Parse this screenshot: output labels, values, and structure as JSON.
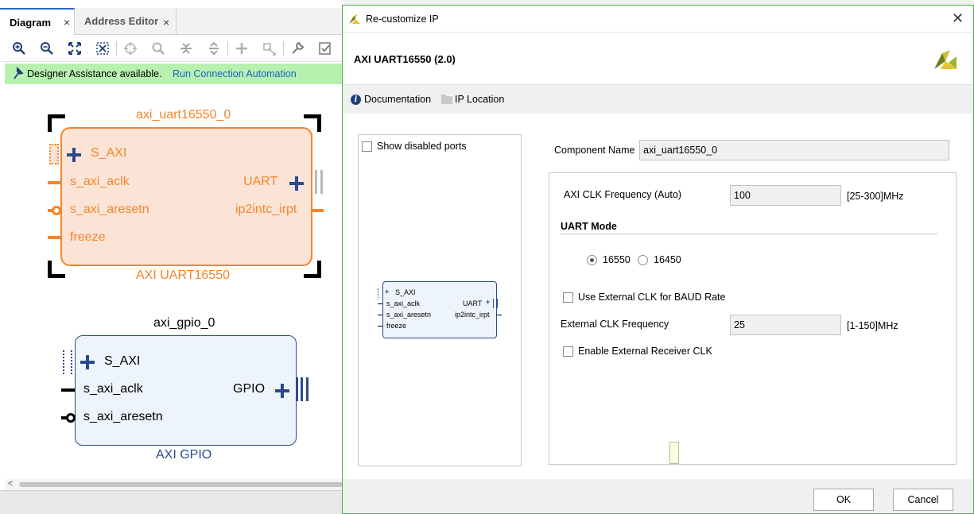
{
  "left_panel": {
    "tabs": [
      {
        "label": "Diagram",
        "active": true
      },
      {
        "label": "Address Editor",
        "active": false
      }
    ],
    "tab_close_glyph": "×",
    "toolbar_icons": [
      "zoom-in-icon",
      "zoom-out-icon",
      "fit-full-icon",
      "fit-selection-icon",
      "crosshair-icon",
      "search-icon",
      "collapse-icon",
      "expand-icon",
      "add-icon",
      "ports-icon",
      "wrench-icon",
      "validate-icon"
    ],
    "assistance": {
      "text": "Designer Assistance available.",
      "link": "Run Connection Automation",
      "color": "#b8f0b0"
    },
    "uart_block": {
      "instance": "axi_uart16550_0",
      "type_label": "AXI UART16550",
      "ports_left": [
        "S_AXI",
        "s_axi_aclk",
        "s_axi_aresetn",
        "freeze"
      ],
      "ports_right": [
        "UART",
        "ip2intc_irpt"
      ],
      "color": "#f5842a",
      "fill": "#fbe4d6"
    },
    "gpio_block": {
      "instance": "axi_gpio_0",
      "type_label": "AXI GPIO",
      "ports_left": [
        "S_AXI",
        "s_axi_aclk",
        "s_axi_aresetn"
      ],
      "ports_right": [
        "GPIO"
      ],
      "color": "#2b4a8c",
      "fill": "#eef4fb"
    }
  },
  "dialog": {
    "title": "Re-customize IP",
    "close_glyph": "✕",
    "ip_name": "AXI UART16550 (2.0)",
    "links": {
      "documentation": "Documentation",
      "ip_location": "IP Location"
    },
    "show_disabled_ports": {
      "label": "Show disabled ports",
      "checked": false
    },
    "preview_ports_left": [
      "S_AXI",
      "s_axi_aclk",
      "s_axi_aresetn",
      "freeze"
    ],
    "preview_ports_right": [
      "UART",
      "ip2intc_irpt"
    ],
    "component_name": {
      "label": "Component Name",
      "value": "axi_uart16550_0"
    },
    "axi_clk": {
      "label": "AXI CLK Frequency (Auto)",
      "value": "100",
      "range": "[25-300]MHz"
    },
    "uart_mode": {
      "heading": "UART Mode",
      "options": [
        "16550",
        "16450"
      ],
      "selected": "16550"
    },
    "use_ext_clk": {
      "label": "Use External CLK for BAUD Rate",
      "checked": false
    },
    "ext_clk": {
      "label": "External CLK Frequency",
      "value": "25",
      "range": "[1-150]MHz"
    },
    "ext_rx_clk": {
      "label": "Enable External Receiver CLK",
      "checked": false
    },
    "buttons": {
      "ok": "OK",
      "cancel": "Cancel"
    },
    "border_color": "#4caf50"
  }
}
